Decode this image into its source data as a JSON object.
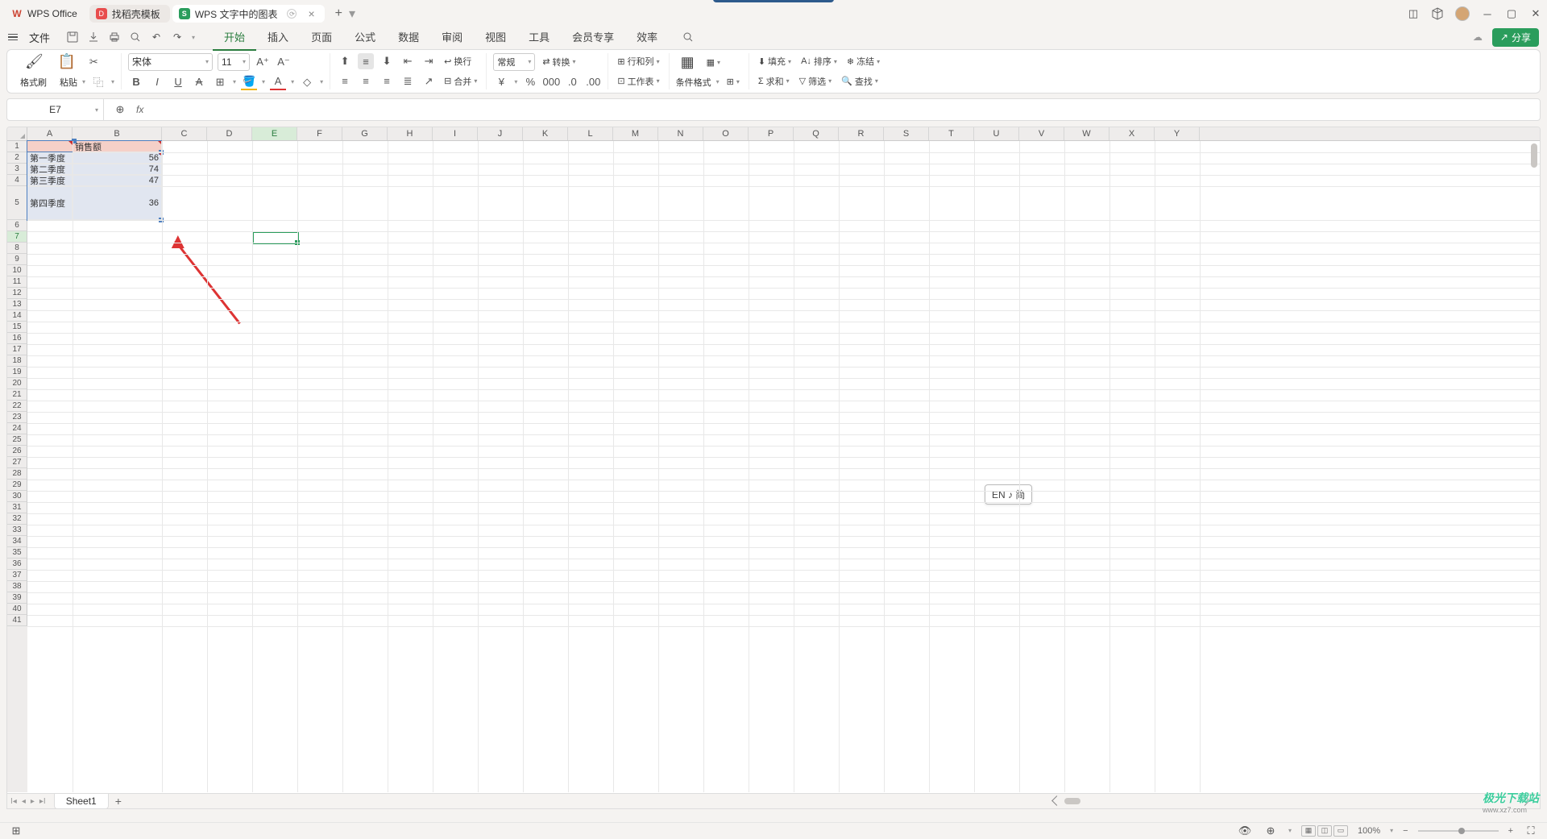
{
  "tabs": {
    "app": "WPS Office",
    "template": "找稻壳模板",
    "doc": "WPS 文字中的图表"
  },
  "menu": {
    "file": "文件",
    "items": [
      "开始",
      "插入",
      "页面",
      "公式",
      "数据",
      "审阅",
      "视图",
      "工具",
      "会员专享",
      "效率"
    ],
    "active_index": 0,
    "share": "分享"
  },
  "ribbon": {
    "format_brush": "格式刷",
    "paste": "粘贴",
    "font_name": "宋体",
    "font_size": "11",
    "wrap": "换行",
    "merge": "合并",
    "number_format": "常规",
    "convert": "转换",
    "rows_cols": "行和列",
    "worksheet": "工作表",
    "cond_format": "条件格式",
    "fill": "填充",
    "sort": "排序",
    "freeze": "冻结",
    "sum": "求和",
    "filter": "筛选",
    "find": "查找"
  },
  "formula_bar": {
    "name_box": "E7",
    "fx": "fx",
    "value": ""
  },
  "columns": [
    "A",
    "B",
    "C",
    "D",
    "E",
    "F",
    "G",
    "H",
    "I",
    "J",
    "K",
    "L",
    "M",
    "N",
    "O",
    "P",
    "Q",
    "R",
    "S",
    "T",
    "U",
    "V",
    "W",
    "X",
    "Y"
  ],
  "selected_col_index": 4,
  "rows_total": 41,
  "tall_row": 5,
  "selected_row": 7,
  "data_cells": {
    "b1": "销售额",
    "a2": "第一季度",
    "b2": "56",
    "a3": "第二季度",
    "b3": "74",
    "a4": "第三季度",
    "b4": "47",
    "a5": "第四季度",
    "b5": "36"
  },
  "selected_cell": "E7",
  "ime": "EN ♪ 简",
  "sheet": {
    "name": "Sheet1"
  },
  "status": {
    "zoom": "100%"
  },
  "watermark": {
    "main": "极光下载站",
    "sub": "www.xz7.com"
  }
}
